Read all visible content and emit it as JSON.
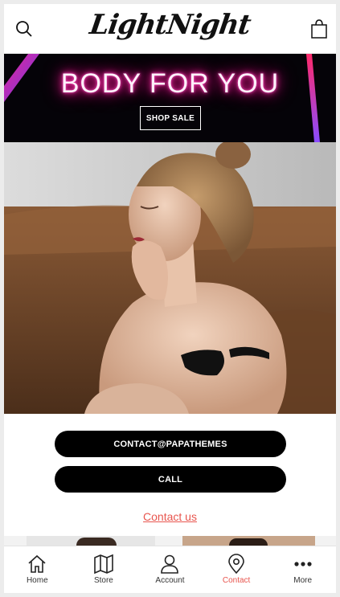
{
  "header": {
    "logo_text": "LightNight",
    "search_icon": "search-icon",
    "cart_icon": "shopping-bag-icon"
  },
  "banner": {
    "title": "BODY FOR YOU",
    "shop_button": "SHOP SALE",
    "neon_color": "#ff1493"
  },
  "contact": {
    "email_button": "CONTACT@PAPATHEMES",
    "call_button": "CALL",
    "contact_link": "Contact us",
    "link_color": "#e8554e"
  },
  "bottom_nav": {
    "items": [
      {
        "label": "Home",
        "icon": "home-icon"
      },
      {
        "label": "Store",
        "icon": "map-icon"
      },
      {
        "label": "Account",
        "icon": "user-icon"
      },
      {
        "label": "Contact",
        "icon": "map-pin-icon",
        "active": true
      },
      {
        "label": "More",
        "icon": "more-dots-icon"
      }
    ],
    "active_color": "#e8554e"
  }
}
